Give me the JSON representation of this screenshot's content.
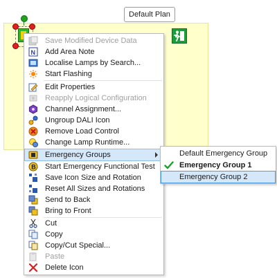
{
  "plan": {
    "title": "Default Plan"
  },
  "context_menu": {
    "items": [
      {
        "label": "Save Modified Device Data",
        "icon": "save-device-icon",
        "enabled": false
      },
      {
        "label": "Add Area Note",
        "icon": "area-note-icon",
        "enabled": true
      },
      {
        "label": "Localise Lamps by Search...",
        "icon": "localise-icon",
        "enabled": true
      },
      {
        "label": "Start Flashing",
        "icon": "flash-icon",
        "enabled": true
      },
      {
        "label": "Edit Properties",
        "icon": "edit-icon",
        "enabled": true
      },
      {
        "label": "Reapply Logical Configuration",
        "icon": "reapply-icon",
        "enabled": false
      },
      {
        "label": "Channel Assignment...",
        "icon": "channel-icon",
        "enabled": true
      },
      {
        "label": "Ungroup DALI Icon",
        "icon": "ungroup-icon",
        "enabled": true
      },
      {
        "label": "Remove Load Control",
        "icon": "remove-load-icon",
        "enabled": true
      },
      {
        "label": "Change Lamp Runtime...",
        "icon": "lamp-runtime-icon",
        "enabled": true
      },
      {
        "label": "Emergency Groups",
        "icon": "emergency-groups-icon",
        "enabled": true,
        "has_submenu": true,
        "selected": true
      },
      {
        "label": "Start Emergency Functional Test",
        "icon": "emergency-test-icon",
        "enabled": true
      },
      {
        "label": "Save Icon Size and Rotation",
        "icon": "save-size-icon",
        "enabled": true
      },
      {
        "label": "Reset All Sizes and Rotations",
        "icon": "reset-size-icon",
        "enabled": true
      },
      {
        "label": "Send to Back",
        "icon": "send-back-icon",
        "enabled": true
      },
      {
        "label": "Bring to Front",
        "icon": "bring-front-icon",
        "enabled": true
      },
      {
        "label": "Cut",
        "icon": "cut-icon",
        "enabled": true
      },
      {
        "label": "Copy",
        "icon": "copy-icon",
        "enabled": true
      },
      {
        "label": "Copy/Cut Special...",
        "icon": "copy-special-icon",
        "enabled": true
      },
      {
        "label": "Paste",
        "icon": "paste-icon",
        "enabled": false
      },
      {
        "label": "Delete Icon",
        "icon": "delete-icon",
        "enabled": true
      }
    ]
  },
  "submenu": {
    "items": [
      {
        "label": "Default Emergency Group",
        "checked": false,
        "bold": false,
        "highlighted": false
      },
      {
        "label": "Emergency Group 1",
        "checked": true,
        "bold": true,
        "highlighted": false
      },
      {
        "label": "Emergency Group 2",
        "checked": false,
        "bold": false,
        "highlighted": true
      }
    ]
  },
  "colors": {
    "area_fill": "#ffffcc",
    "menu_selection": "#d5e8fa",
    "check_green": "#1b9e2a"
  }
}
